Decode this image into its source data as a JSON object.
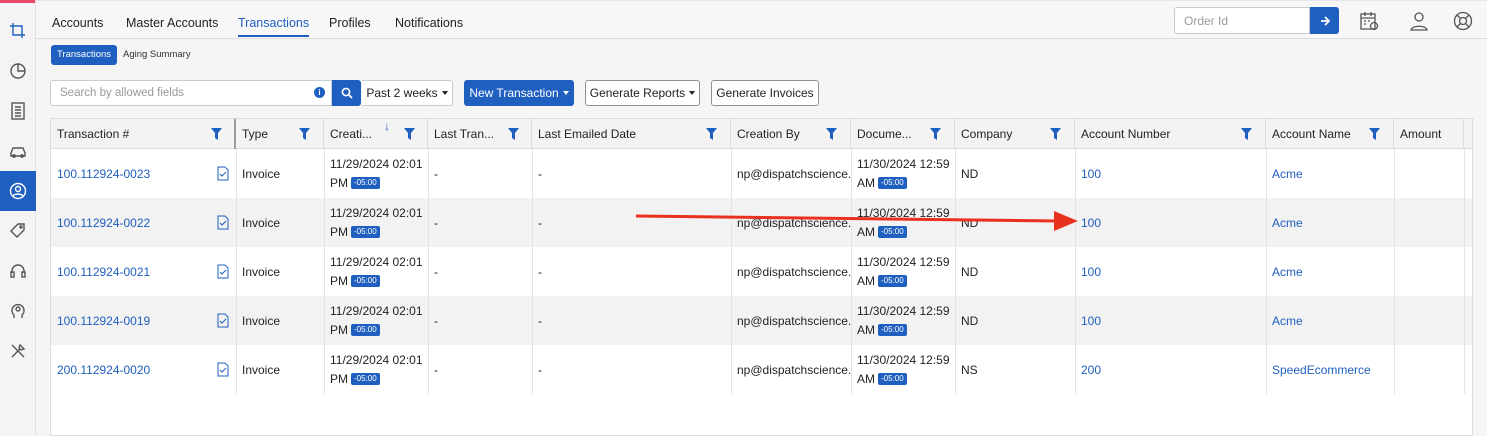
{
  "nav": {
    "tabs": [
      "Accounts",
      "Master Accounts",
      "Transactions",
      "Profiles",
      "Notifications"
    ],
    "active_tab": "Transactions",
    "order_placeholder": "Order Id"
  },
  "subtabs": [
    "Transactions",
    "Aging Summary"
  ],
  "toolbar": {
    "search_placeholder": "Search by allowed fields",
    "period": "Past 2 weeks",
    "new_transaction": "New Transaction",
    "generate_reports": "Generate Reports",
    "generate_invoices": "Generate Invoices"
  },
  "columns": [
    "Transaction #",
    "Type",
    "Creati...",
    "Last Tran...",
    "Last Emailed Date",
    "Creation By",
    "Docume...",
    "Company",
    "Account Number",
    "Account Name",
    "Amount"
  ],
  "rows": [
    {
      "txn": "100.112924-0023",
      "type": "Invoice",
      "created_line1": "11/29/2024 02:01",
      "created_line2": "PM",
      "tz": "-05:00",
      "last_tran": "-",
      "last_emailed": "-",
      "created_by": "np@dispatchscience...",
      "doc_line1": "11/30/2024 12:59",
      "doc_line2": "AM",
      "doc_tz": "-05:00",
      "company": "ND",
      "account_number": "100",
      "account_name": "Acme"
    },
    {
      "txn": "100.112924-0022",
      "type": "Invoice",
      "created_line1": "11/29/2024 02:01",
      "created_line2": "PM",
      "tz": "-05:00",
      "last_tran": "-",
      "last_emailed": "-",
      "created_by": "np@dispatchscience...",
      "doc_line1": "11/30/2024 12:59",
      "doc_line2": "AM",
      "doc_tz": "-05:00",
      "company": "ND",
      "account_number": "100",
      "account_name": "Acme"
    },
    {
      "txn": "100.112924-0021",
      "type": "Invoice",
      "created_line1": "11/29/2024 02:01",
      "created_line2": "PM",
      "tz": "-05:00",
      "last_tran": "-",
      "last_emailed": "-",
      "created_by": "np@dispatchscience...",
      "doc_line1": "11/30/2024 12:59",
      "doc_line2": "AM",
      "doc_tz": "-05:00",
      "company": "ND",
      "account_number": "100",
      "account_name": "Acme"
    },
    {
      "txn": "100.112924-0019",
      "type": "Invoice",
      "created_line1": "11/29/2024 02:01",
      "created_line2": "PM",
      "tz": "-05:00",
      "last_tran": "-",
      "last_emailed": "-",
      "created_by": "np@dispatchscience...",
      "doc_line1": "11/30/2024 12:59",
      "doc_line2": "AM",
      "doc_tz": "-05:00",
      "company": "ND",
      "account_number": "100",
      "account_name": "Acme"
    },
    {
      "txn": "200.112924-0020",
      "type": "Invoice",
      "created_line1": "11/29/2024 02:01",
      "created_line2": "PM",
      "tz": "-05:00",
      "last_tran": "-",
      "last_emailed": "-",
      "created_by": "np@dispatchscience...",
      "doc_line1": "11/30/2024 12:59",
      "doc_line2": "AM",
      "doc_tz": "-05:00",
      "company": "NS",
      "account_number": "200",
      "account_name": "SpeedEcommerce"
    }
  ],
  "colors": {
    "accent": "#1f5fbf",
    "annotation_arrow": "#e8321e",
    "rail_top": "#e8496b"
  }
}
